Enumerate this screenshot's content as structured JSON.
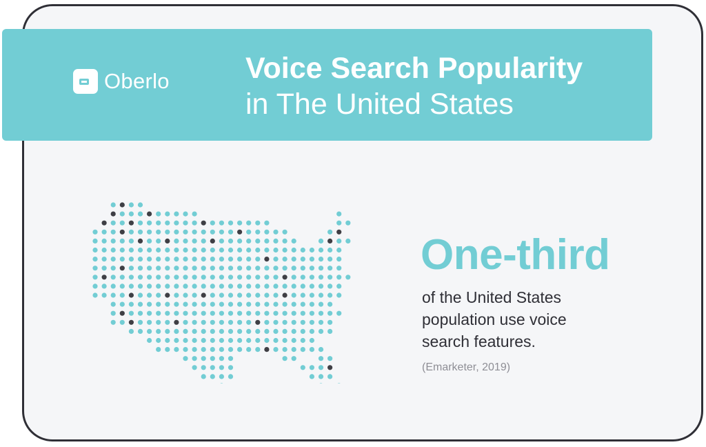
{
  "brand": {
    "name": "Oberlo"
  },
  "title": {
    "line1": "Voice Search Popularity",
    "line2": "in The United States"
  },
  "stat": {
    "headline": "One-third",
    "line1": "of the United States",
    "line2": "population use voice",
    "line3": "search features.",
    "source": "(Emarketer, 2019)"
  },
  "colors": {
    "accent": "#72cdd4",
    "dot_dark": "#3f3f45",
    "text_dark": "#2f2f36",
    "source_gray": "#8e8e95",
    "card_bg": "#f5f6f8"
  },
  "icons": {
    "logo": "price-tag-icon"
  },
  "map_grid": [
    "..TDTT.......................",
    "..DTTTDTTTTT...............T",
    ".DTTDTTTTTTTDTTTTTTT.......TT",
    "TTTDTTTTTTTTTTTTDTTTTT....TD",
    "TTTTTDTTDTTTTDTTTTTTTTT..TDTT",
    "TTTTTTTTTTTTTTTTTTTTTTTTTTTT",
    "TTTTTTTTTTTTTTTTTTTDTTTTTTTT",
    "TTTDTTTTTTTTTTTTTTTTTTTTTTTT",
    "TDTTTTTTTTTTTTTTTTTTTDTTTTTTT",
    "TTTTTTTTTTTTTTTTTTTTTTTTTTTT",
    "TTTTDTTTDTTTDTTTTTTTTDTTTTTT",
    "..TTTTTTTTTTTTTTTTTTTTTTTTT",
    "..TDTTTTTTTTTTTTTTTTTTTTTTTT",
    "..TTDTTTTDTTTTTTTTDTTTTTTTT",
    "....TTTTTTTTTTTTTTTTTTTTTTT",
    "......TTTTTTTTTTTTTTTTTTT",
    ".......TTTTTTTTTTTTDTTTTTT",
    "..........TTTTTT.....TT..TT",
    "...........TTTTT.......TTTD",
    "............TTTT........TTT",
    "..............T..........T.T"
  ]
}
